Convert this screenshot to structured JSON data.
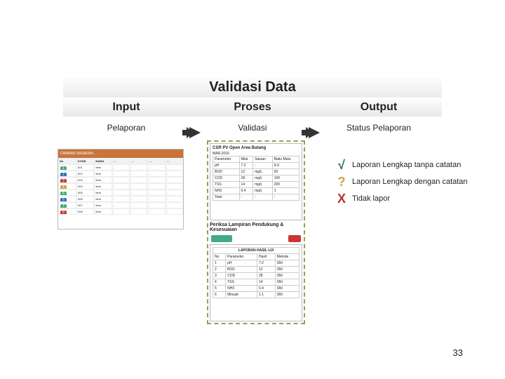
{
  "title": "Validasi Data",
  "columns": {
    "input": "Input",
    "process": "Proses",
    "output": "Output"
  },
  "sub": {
    "input": "Pelaporan",
    "process": "Validasi",
    "output": "Status Pelaporan"
  },
  "process": {
    "sheet1_header": "CSR PV Open Area Batang",
    "sheet1_period": "MAR-2016",
    "caption": "Periksa Lampiran Pendukung & Kesesuaian"
  },
  "legend": {
    "ok": {
      "glyph": "√",
      "text": "Laporan Lengkap tanpa catatan"
    },
    "q": {
      "glyph": "?",
      "text": "Laporan Lengkap dengan catatan"
    },
    "bad": {
      "glyph": "X",
      "text": "Tidak lapor"
    }
  },
  "page_number": "33",
  "chart_data": {
    "type": "table",
    "note": "diagram slide — no quantitative chart; three-stage flow Input→Proses→Output with three status outcomes",
    "stages": [
      "Input / Pelaporan",
      "Proses / Validasi",
      "Output / Status Pelaporan"
    ],
    "statuses": [
      "Laporan Lengkap tanpa catatan",
      "Laporan Lengkap dengan catatan",
      "Tidak lapor"
    ]
  }
}
